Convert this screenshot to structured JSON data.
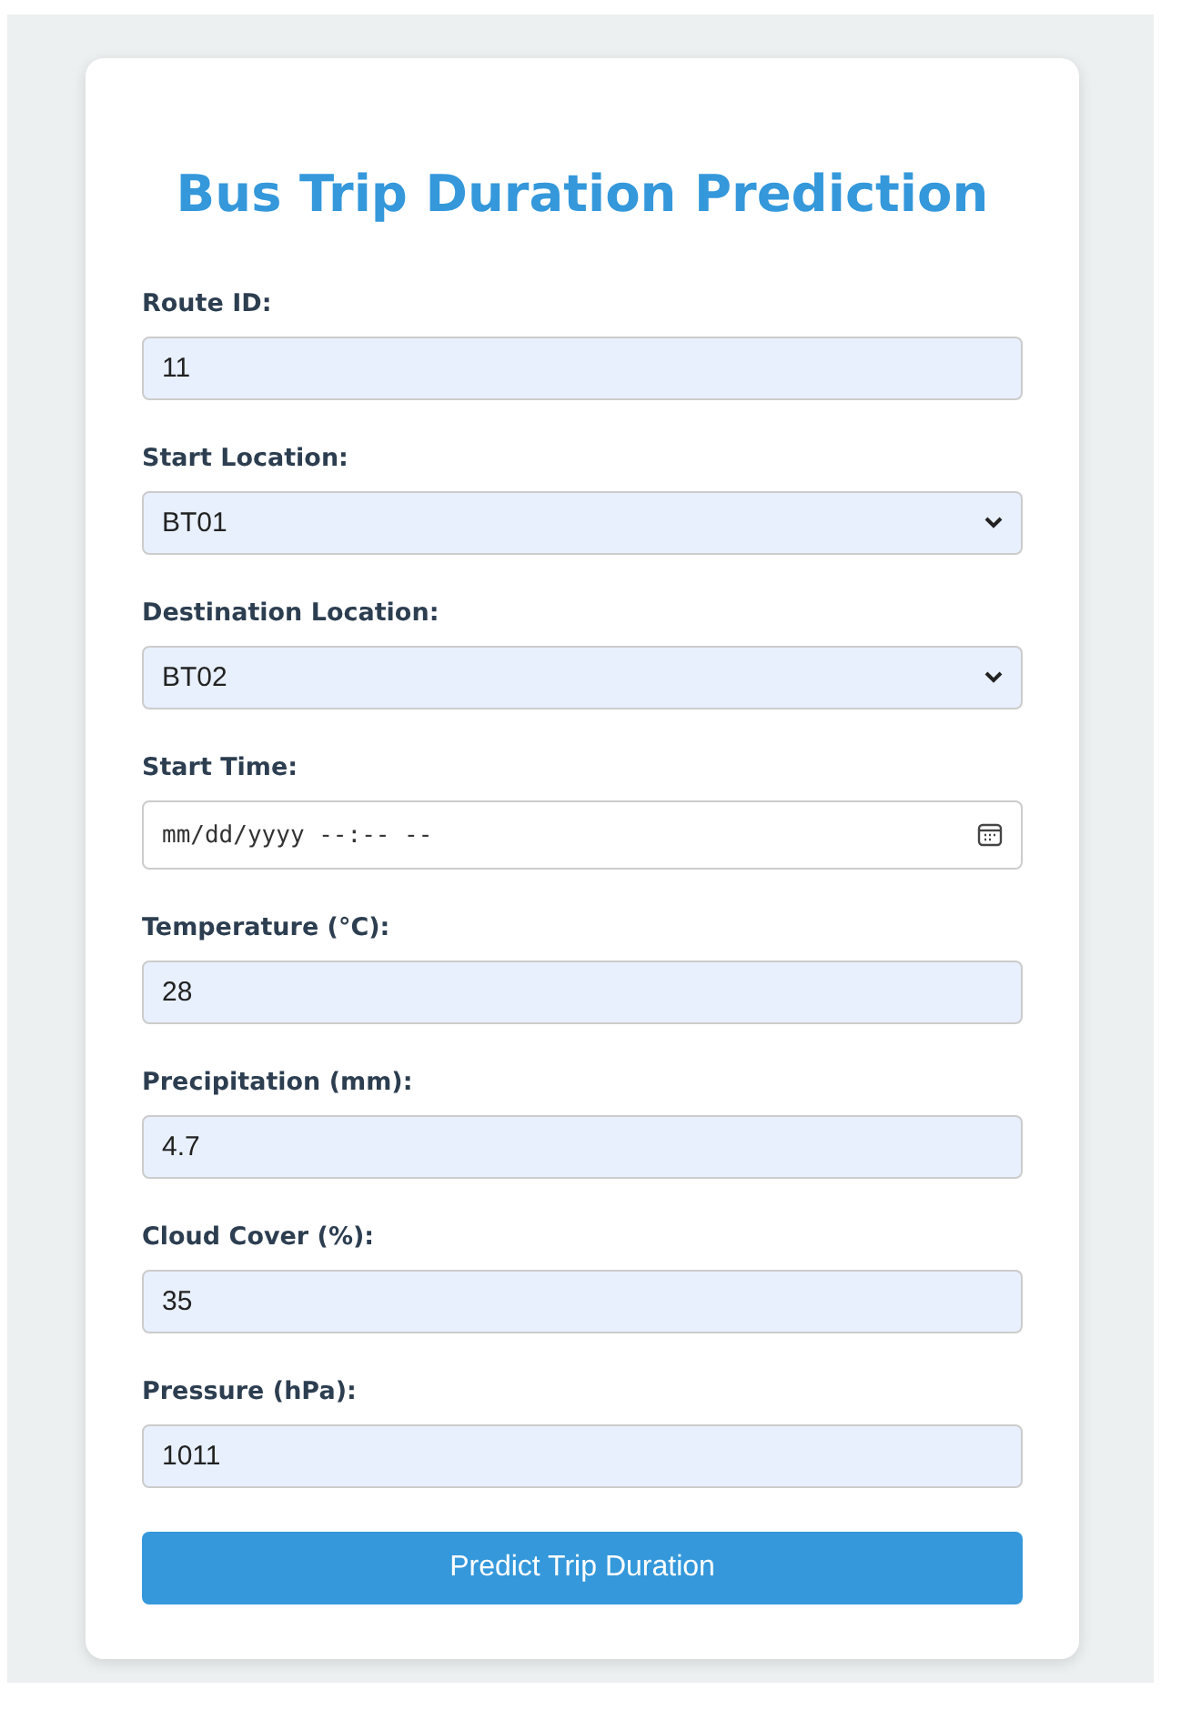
{
  "title": "Bus Trip Duration Prediction",
  "fields": [
    {
      "label": "Route ID:",
      "kind": "text",
      "value": "11"
    },
    {
      "label": "Start Location:",
      "kind": "select",
      "value": "BT01"
    },
    {
      "label": "Destination Location:",
      "kind": "select",
      "value": "BT02"
    },
    {
      "label": "Start Time:",
      "kind": "datetime",
      "placeholder": "mm/dd/yyyy --:-- --"
    },
    {
      "label": "Temperature (°C):",
      "kind": "text",
      "value": "28"
    },
    {
      "label": "Precipitation (mm):",
      "kind": "text",
      "value": "4.7"
    },
    {
      "label": "Cloud Cover (%):",
      "kind": "text",
      "value": "35"
    },
    {
      "label": "Pressure (hPa):",
      "kind": "text",
      "value": "1011"
    }
  ],
  "button": "Predict Trip Duration"
}
